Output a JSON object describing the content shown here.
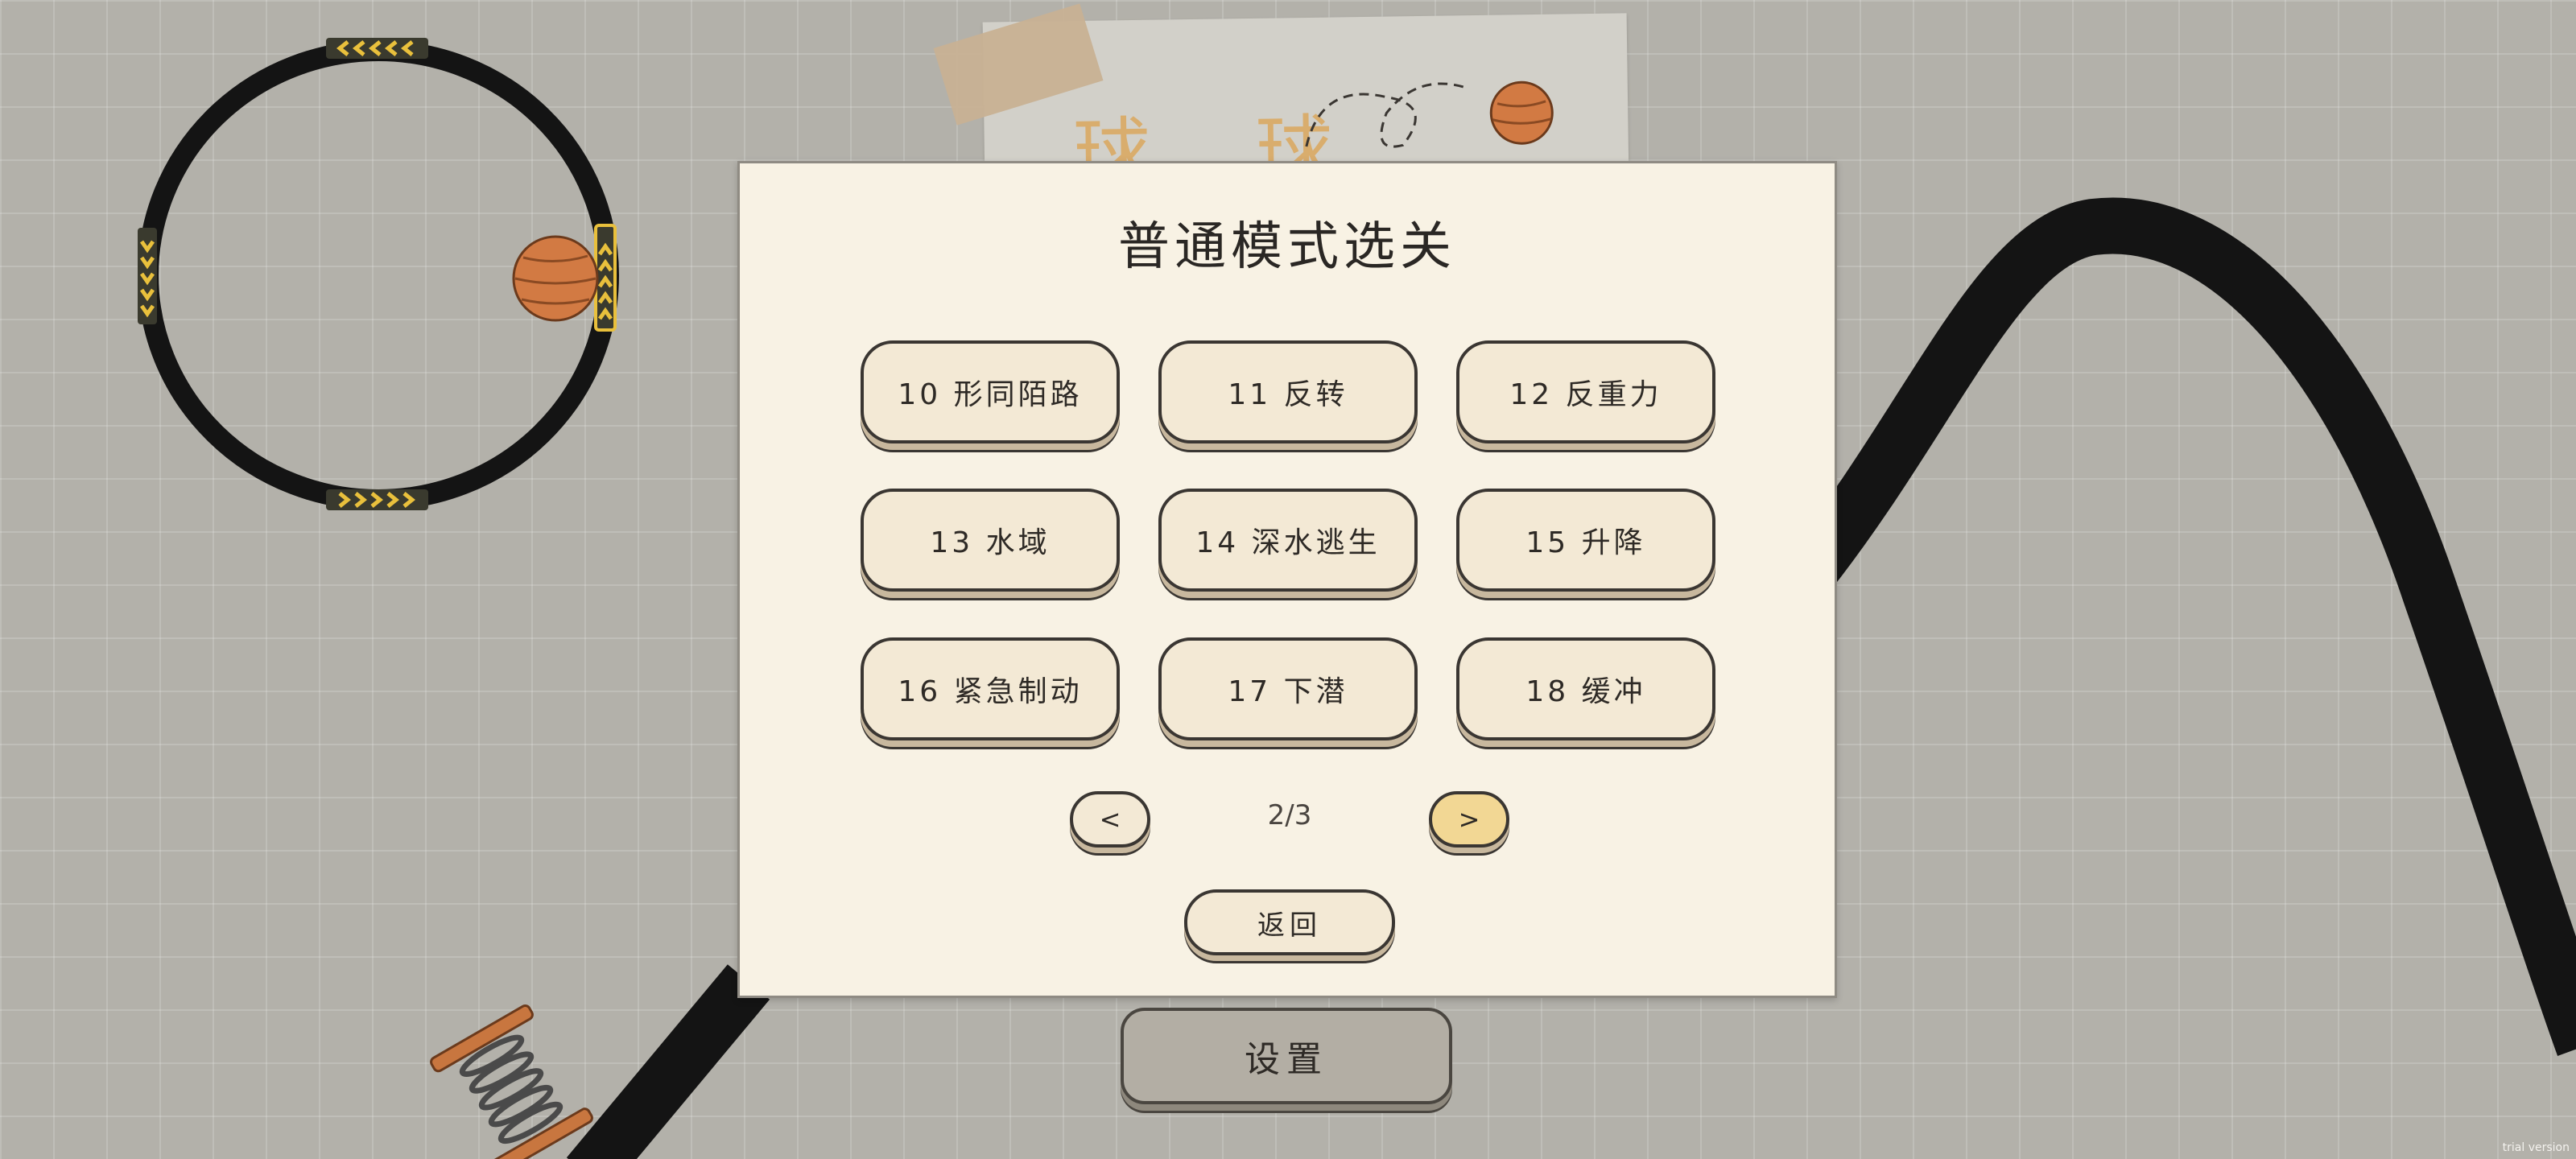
{
  "background_title": "球 球",
  "dialog": {
    "title": "普通模式选关",
    "levels": [
      {
        "label": "10 形同陌路"
      },
      {
        "label": "11 反转"
      },
      {
        "label": "12 反重力"
      },
      {
        "label": "13 水域"
      },
      {
        "label": "14 深水逃生"
      },
      {
        "label": "15 升降"
      },
      {
        "label": "16 紧急制动"
      },
      {
        "label": "17 下潜"
      },
      {
        "label": "18 缓冲"
      }
    ],
    "prev_label": "<",
    "next_label": ">",
    "page_indicator": "2/3",
    "back_label": "返回"
  },
  "settings_label": "设置",
  "watermark": "trial version",
  "colors": {
    "background": "#b3b1aa",
    "dialog": "#f8f2e4",
    "button": "#f3e9d5",
    "next_button": "#f2d794",
    "ball": "#d27a43",
    "track": "#141414",
    "hazard_stripe": "#e9c03c"
  }
}
